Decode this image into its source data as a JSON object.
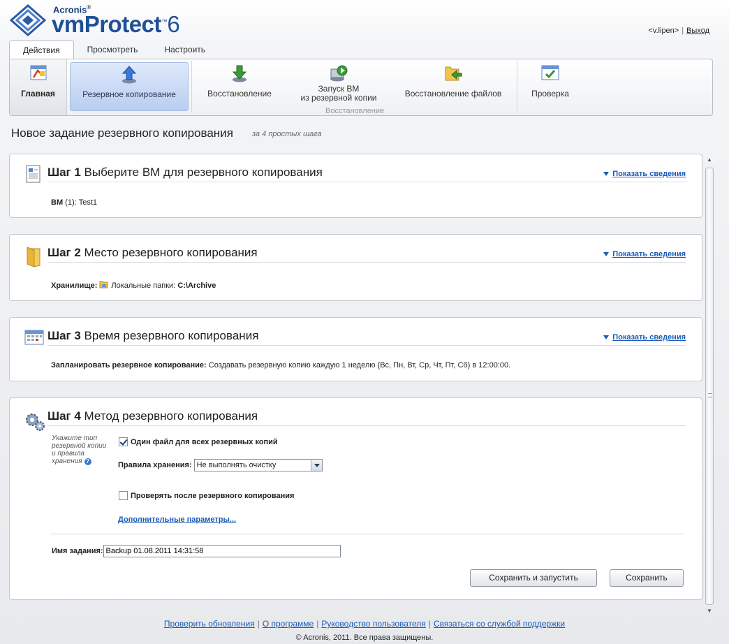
{
  "header": {
    "brand_small": "Acronis",
    "brand_product": "vmProtect",
    "brand_version": "6",
    "user": "<v.lipen>",
    "logout": "Выход"
  },
  "tabs": [
    {
      "label": "Действия",
      "active": true
    },
    {
      "label": "Просмотреть",
      "active": false
    },
    {
      "label": "Настроить",
      "active": false
    }
  ],
  "ribbon": {
    "home": "Главная",
    "backup": "Резервное копирование",
    "restore": "Восстановление",
    "run_vm_line1": "Запуск ВМ",
    "run_vm_line2": "из резервной копии",
    "file_restore": "Восстановление файлов",
    "validate": "Проверка",
    "group_label": "Восстановление"
  },
  "page": {
    "title": "Новое задание резервного копирования",
    "subtitle": "за 4 простых шага"
  },
  "steps": {
    "show_details": "Показать сведения",
    "step1": {
      "num": "Шаг 1",
      "title": "Выберите ВМ для резервного копирования",
      "vm_label": "ВМ",
      "vm_value": "(1): Test1"
    },
    "step2": {
      "num": "Шаг 2",
      "title": "Место резервного копирования",
      "storage_label": "Хранилище:",
      "storage_type": "Локальные папки:",
      "storage_path": "C:\\Archive"
    },
    "step3": {
      "num": "Шаг 3",
      "title": "Время резервного копирования",
      "schedule_label": "Запланировать резервное копирование:",
      "schedule_value": "Создавать резервную копию каждую 1 неделю (Вс, Пн, Вт, Ср, Чт, Пт, Сб) в 12:00:00."
    },
    "step4": {
      "num": "Шаг 4",
      "title": "Метод резервного копирования",
      "hint": "Укажите тип резервной копии и правила хранения",
      "single_file_label": "Один файл для всех резервных копий",
      "single_file_checked": true,
      "retention_label": "Правила хранения:",
      "retention_value": "Не выполнять очистку",
      "validate_label": "Проверять после резервного копирования",
      "validate_checked": false,
      "advanced": "Дополнительные параметры...",
      "task_name_label": "Имя задания:",
      "task_name_value": "Backup 01.08.2011 14:31:58",
      "save_run": "Сохранить и запустить",
      "save": "Сохранить"
    }
  },
  "footer": {
    "links": [
      "Проверить обновления",
      "О программе",
      "Руководство пользователя",
      "Связаться со службой поддержки"
    ],
    "copyright": "© Acronis, 2011. Все права защищены."
  },
  "colors": {
    "link": "#1c5bb8",
    "brand": "#1f4f96",
    "active_ribbon": "#b9cdf0"
  },
  "icons": {
    "logo": "acronis-logo-icon",
    "home": "home-icon",
    "backup": "upload-arrow-icon",
    "restore": "download-arrow-icon",
    "run_vm": "run-vm-icon",
    "file_restore": "folder-arrow-icon",
    "validate": "check-window-icon"
  }
}
